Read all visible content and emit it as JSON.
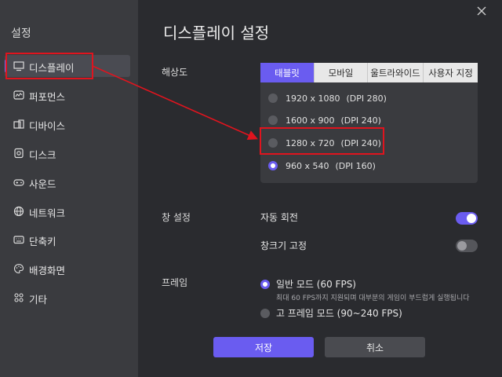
{
  "sidebar": {
    "title": "설정",
    "items": [
      {
        "label": "디스플레이",
        "icon": "monitor-icon"
      },
      {
        "label": "퍼포먼스",
        "icon": "performance-icon"
      },
      {
        "label": "디바이스",
        "icon": "device-icon"
      },
      {
        "label": "디스크",
        "icon": "disk-icon"
      },
      {
        "label": "사운드",
        "icon": "gamepad-icon"
      },
      {
        "label": "네트워크",
        "icon": "globe-icon"
      },
      {
        "label": "단축키",
        "icon": "keyboard-icon"
      },
      {
        "label": "배경화면",
        "icon": "palette-icon"
      },
      {
        "label": "기타",
        "icon": "grid-icon"
      }
    ]
  },
  "main": {
    "title": "디스플레이 설정",
    "resolution": {
      "label": "해상도",
      "tabs": [
        "태블릿",
        "모바일",
        "울트라와이드",
        "사용자 지정"
      ],
      "active_tab": "태블릿",
      "options": [
        {
          "res": "1920 x 1080",
          "dpi": "(DPI 280)",
          "selected": false
        },
        {
          "res": "1600 x 900",
          "dpi": "(DPI 240)",
          "selected": false
        },
        {
          "res": "1280 x 720",
          "dpi": "(DPI 240)",
          "selected": false
        },
        {
          "res": "960 x 540",
          "dpi": "(DPI 160)",
          "selected": true
        }
      ]
    },
    "window": {
      "label": "창 설정",
      "auto_rotate": {
        "label": "자동 회전",
        "on": true
      },
      "fixed_size": {
        "label": "창크기 고정",
        "on": false
      }
    },
    "frame": {
      "label": "프레임",
      "normal": {
        "label": "일반 모드 (60 FPS)",
        "note": "최대 60 FPS까지 지원되며 대부분의 게임이 부드럽게 실행됩니다",
        "selected": true
      },
      "high": {
        "label": "고 프레임 모드 (90~240 FPS)",
        "selected": false
      }
    },
    "buttons": {
      "save": "저장",
      "cancel": "취소"
    }
  },
  "colors": {
    "accent": "#6a5cf0",
    "annotation": "#e0141e",
    "sidebar_bg": "#3a3b3f",
    "main_bg": "#2a2b2f"
  }
}
